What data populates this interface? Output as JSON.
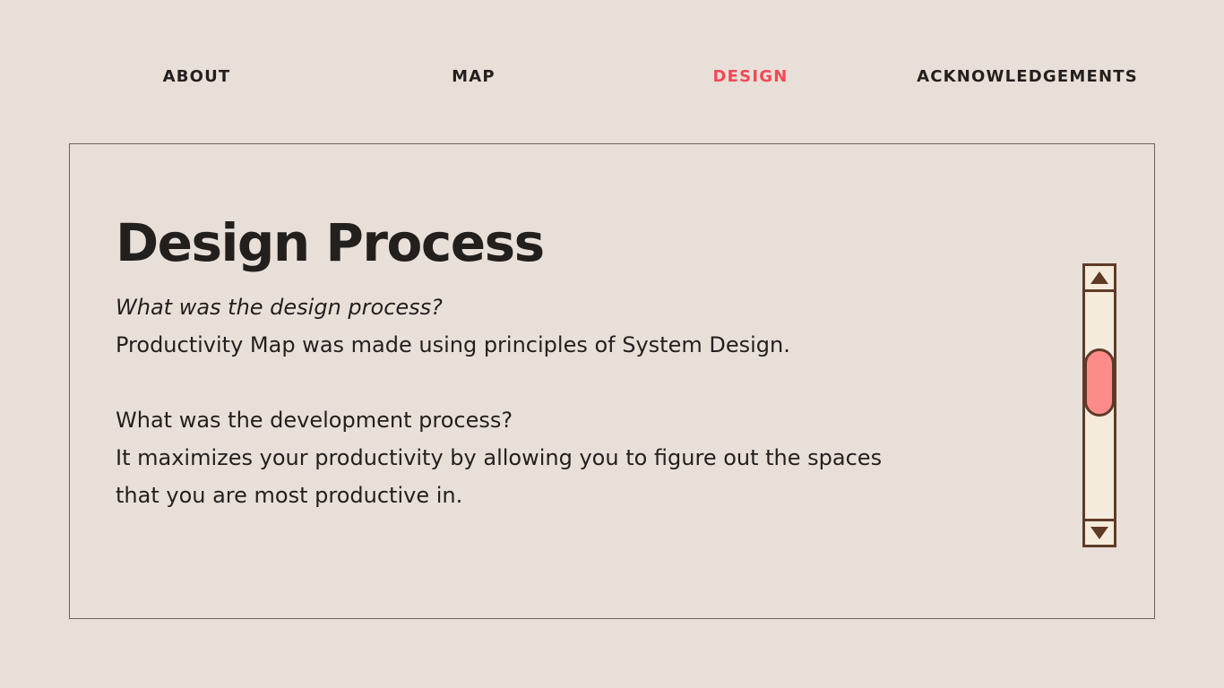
{
  "nav": {
    "items": [
      {
        "label": "ABOUT",
        "active": false
      },
      {
        "label": "MAP",
        "active": false
      },
      {
        "label": "DESIGN",
        "active": true
      },
      {
        "label": "ACKNOWLEDGEMENTS",
        "active": false
      }
    ],
    "active_color": "#f14a56"
  },
  "content": {
    "title": "Design Process",
    "question_1": "What was the design process?",
    "answer_1": "Productivity Map was made using principles of System Design.",
    "question_2": "What was the development process?",
    "answer_2_line_1": "It maximizes your productivity by allowing you to figure out the spaces",
    "answer_2_line_2": "that you are most productive in."
  },
  "scrollbar": {
    "up_icon": "triangle-up-icon",
    "down_icon": "triangle-down-icon",
    "thumb_color": "#fd8b8a",
    "frame_color": "#5f3b27"
  },
  "colors": {
    "background": "#e8dfd9",
    "text": "#231f1d"
  }
}
